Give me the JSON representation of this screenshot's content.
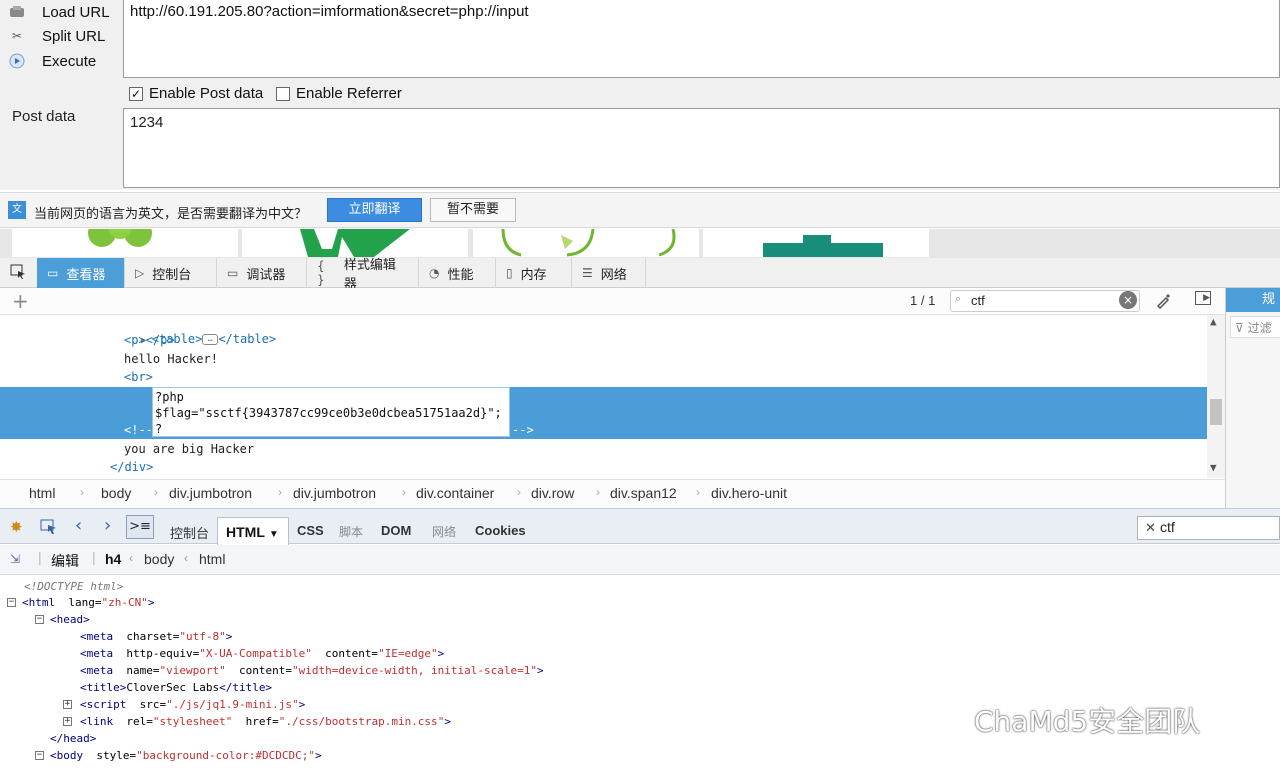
{
  "hackbar": {
    "buttons": [
      "Load URL",
      "Split URL",
      "Execute"
    ],
    "url": "http://60.191.205.80?action=imformation&secret=php://input",
    "enable_post": "Enable Post data",
    "enable_referrer": "Enable Referrer",
    "post_label": "Post data",
    "post_value": "1234"
  },
  "translate": {
    "message": "当前网页的语言为英文，是否需要翻译为中文？",
    "translate_button": "立即翻译",
    "decline_button": "暂不需要"
  },
  "devtools": {
    "tabs": [
      "查看器",
      "控制台",
      "调试器",
      "样式编辑器",
      "性能",
      "内存",
      "网络"
    ],
    "active_tab": "查看器",
    "match_count": "1 / 1",
    "search_value": "ctf",
    "right_tab": "规",
    "right_filter": "过滤"
  },
  "markup": {
    "lines": [
      "<table>",
      "</table>",
      "<p></p>",
      "hello Hacker!",
      "<br>",
      "<!--",
      "-->",
      "you are big Hacker",
      "</div>"
    ],
    "comment": [
      "?php",
      "$flag=\"ssctf{3943787cc99ce0b3e0dcbea51751aa2d}\";",
      "?"
    ]
  },
  "breadcrumb": [
    "html",
    "body",
    "div.jumbotron",
    "div.jumbotron",
    "div.container",
    "div.row",
    "div.span12",
    "div.hero-unit"
  ],
  "firebug": {
    "tabs": [
      "控制台",
      "HTML",
      "CSS",
      "脚本",
      "DOM",
      "网络",
      "Cookies"
    ],
    "search_value": "ctf",
    "edit_label": "编辑",
    "path": [
      "h4",
      "body",
      "html"
    ],
    "tree": {
      "doctype": "<!DOCTYPE html>",
      "html_lang": "zh-CN",
      "meta_charset": "utf-8",
      "meta_http_equiv": "X-UA-Compatible",
      "meta_content_edge": "IE=edge",
      "meta_name": "viewport",
      "meta_viewport_content": "width=device-width, initial-scale=1",
      "title": "CloverSec Labs",
      "script_src": "./js/jq1.9-mini.js",
      "link_rel": "stylesheet",
      "link_href": "./css/bootstrap.min.css",
      "body_style": "background-color:#DCDCDC;"
    }
  },
  "watermark": "ChaMd5安全团队",
  "colors": {
    "accent": "#4c9ed9",
    "selection": "#4b9dd8",
    "tag": "#1a6fb5"
  }
}
